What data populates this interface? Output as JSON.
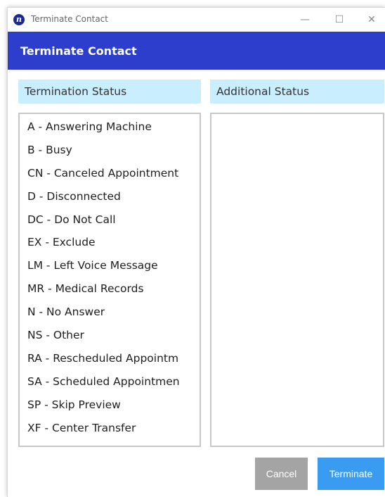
{
  "window": {
    "title": "Terminate Contact",
    "app_icon_letter": "n",
    "controls": {
      "minimize": "—",
      "maximize": "☐",
      "close": "✕"
    }
  },
  "header": {
    "title": "Terminate Contact"
  },
  "termination_status": {
    "heading": "Termination Status",
    "items": [
      "A - Answering Machine",
      "B - Busy",
      "CN - Canceled Appointment",
      "D - Disconnected",
      "DC - Do Not Call",
      "EX - Exclude",
      "LM - Left Voice Message",
      "MR - Medical Records",
      "N - No Answer",
      "NS - Other",
      "RA - Rescheduled Appointm",
      "SA - Scheduled Appointmen",
      "SP - Skip Preview",
      "XF - Center Transfer"
    ]
  },
  "additional_status": {
    "heading": "Additional Status",
    "items": []
  },
  "buttons": {
    "cancel": "Cancel",
    "terminate": "Terminate"
  },
  "colors": {
    "header_bg": "#2d3ecc",
    "panel_head_bg": "#c9eefd",
    "cancel_bg": "#a4a4a4",
    "terminate_bg": "#3a9cf0"
  }
}
